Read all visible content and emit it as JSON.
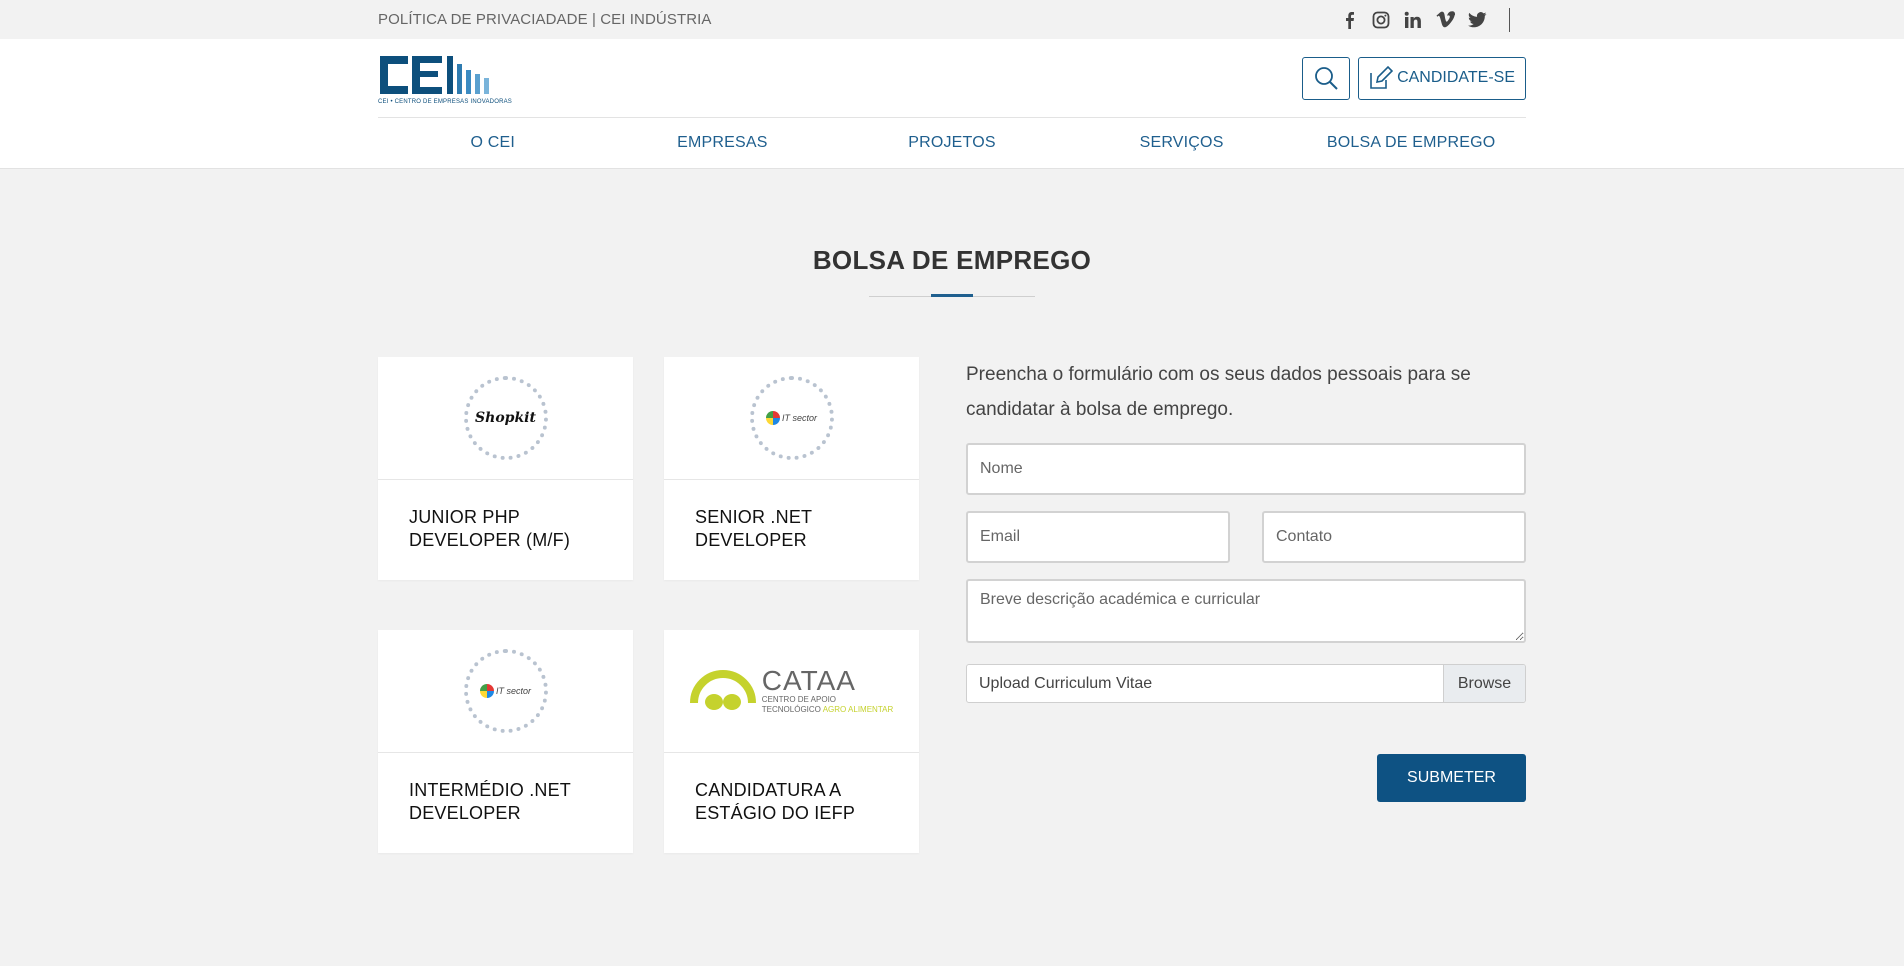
{
  "topbar": {
    "links_text": "POLÍTICA DE PRIVACIADADE | CEI INDÚSTRIA",
    "social": [
      "facebook-icon",
      "instagram-icon",
      "linkedin-icon",
      "vimeo-icon",
      "twitter-icon"
    ]
  },
  "header": {
    "logo_text": "CEI",
    "logo_subtitle": "CEI • CENTRO DE EMPRESAS INOVADORAS",
    "candidate_label": "CANDIDATE-SE"
  },
  "nav": {
    "items": [
      {
        "label": "O CEI"
      },
      {
        "label": "EMPRESAS"
      },
      {
        "label": "PROJETOS"
      },
      {
        "label": "SERVIÇOS"
      },
      {
        "label": "BOLSA DE EMPREGO"
      }
    ]
  },
  "main": {
    "title": "BOLSA DE EMPREGO",
    "jobs": [
      {
        "title_line1": "JUNIOR PHP",
        "title_line2": "DEVELOPER (M/F)",
        "company": "Shopkit"
      },
      {
        "title_line1": "SENIOR .NET",
        "title_line2": "DEVELOPER",
        "company": "IT sector"
      },
      {
        "title_line1": "INTERMÉDIO .NET",
        "title_line2": "DEVELOPER",
        "company": "IT sector"
      },
      {
        "title_line1": "CANDIDATURA A",
        "title_line2": "ESTÁGIO DO IEFP",
        "company": "CATAA",
        "company_sub1": "CENTRO DE APOIO",
        "company_sub2a": "TECNOLÓGICO ",
        "company_sub2b": "AGRO ALIMENTAR"
      }
    ]
  },
  "form": {
    "intro": "Preencha o formulário com os seus dados pessoais para se candidatar à bolsa de emprego.",
    "nome_placeholder": "Nome",
    "email_placeholder": "Email",
    "contato_placeholder": "Contato",
    "desc_placeholder": "Breve descrição académica e curricular",
    "upload_label": "Upload Curriculum Vitae",
    "browse_label": "Browse",
    "submit_label": "SUBMETER"
  },
  "colors": {
    "brand": "#0e5283",
    "nav_text": "#1f5f8e",
    "cataa_green": "#c5d22d"
  }
}
